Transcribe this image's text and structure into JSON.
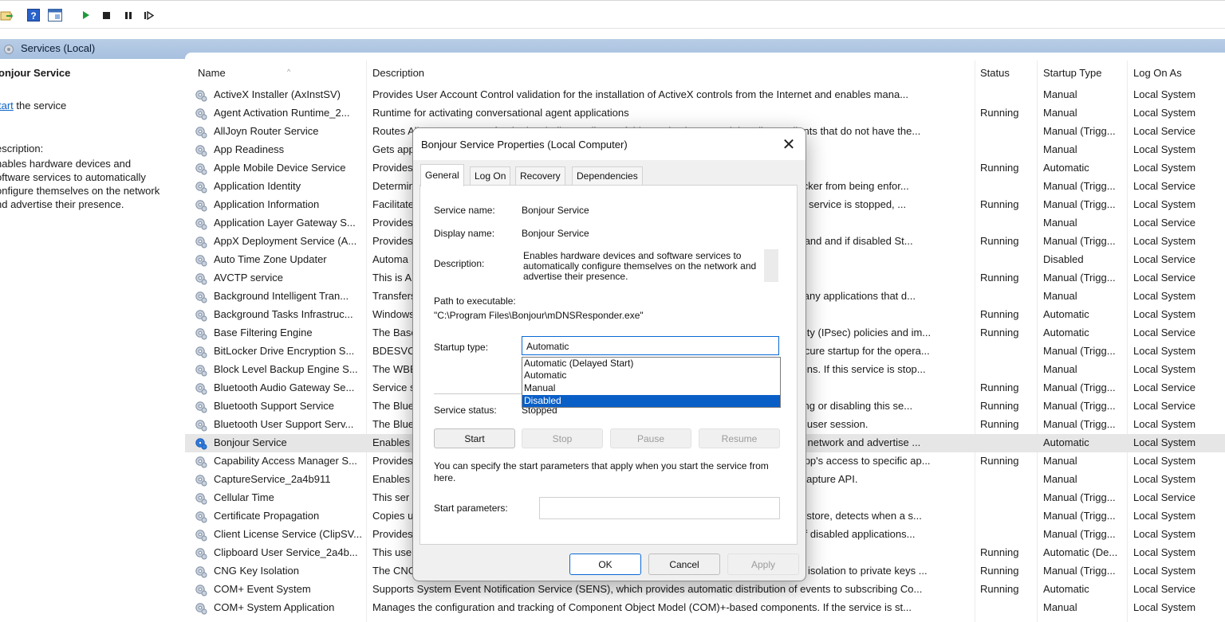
{
  "scope": {
    "title": "Services (Local)"
  },
  "left_pane": {
    "title": "onjour Service",
    "start_link": "tart",
    "start_prefix": "S",
    "start_suffix": " the service",
    "desc_label": "escription:",
    "desc_lines": [
      "nables hardware devices and",
      "oftware services to automatically",
      "onfigure themselves on the network",
      "nd advertise their presence."
    ]
  },
  "columns": {
    "name": "Name",
    "description": "Description",
    "status": "Status",
    "startup_type": "Startup Type",
    "log_on_as": "Log On As"
  },
  "rows": [
    {
      "name": "ActiveX Installer (AxInstSV)",
      "desc": "Provides User Account Control validation for the installation of ActiveX controls from the Internet and enables mana...",
      "status": "",
      "startup": "Manual",
      "logon": "Local System"
    },
    {
      "name": "Agent Activation Runtime_2...",
      "desc": "Runtime for activating conversational agent applications",
      "status": "Running",
      "startup": "Manual",
      "logon": "Local System"
    },
    {
      "name": "AllJoyn Router Service",
      "desc": "Routes AllJoyn messages for the local AllJoyn clients. If this service is stopped the AllJoyn clients that do not have the...",
      "status": "",
      "startup": "Manual (Trigg...",
      "logon": "Local Service"
    },
    {
      "name": "App Readiness",
      "desc": "Gets apps ready for use the first time a user signs in to this PC and when adding new apps.",
      "status": "",
      "startup": "Manual",
      "logon": "Local System"
    },
    {
      "name": "Apple Mobile Device Service",
      "desc": "Provides",
      "status": "Running",
      "startup": "Automatic",
      "logon": "Local System"
    },
    {
      "name": "Application Identity",
      "desc": "Determines and verifies the identity of an application. Disabling this service will prevent AppLocker from being enfor...",
      "status": "",
      "startup": "Manual (Trigg...",
      "logon": "Local Service"
    },
    {
      "name": "Application Information",
      "desc": "Facilitates the running of interactive applications with additional administrative privileges.  If this service is stopped, ...",
      "status": "Running",
      "startup": "Manual (Trigg...",
      "logon": "Local System"
    },
    {
      "name": "Application Layer Gateway S...",
      "desc": "Provides",
      "status": "",
      "startup": "Manual",
      "logon": "Local Service"
    },
    {
      "name": "AppX Deployment Service (A...",
      "desc": "Provides infrastructure support for deploying Store applications. This service is started on demand and if disabled St...",
      "status": "Running",
      "startup": "Manual (Trigg...",
      "logon": "Local System"
    },
    {
      "name": "Auto Time Zone Updater",
      "desc": "Automa",
      "status": "",
      "startup": "Disabled",
      "logon": "Local Service"
    },
    {
      "name": "AVCTP service",
      "desc": "This is A",
      "status": "Running",
      "startup": "Manual (Trigg...",
      "logon": "Local Service"
    },
    {
      "name": "Background Intelligent Tran...",
      "desc": "Transfers files in the background using idle network bandwidth. If the service is disabled, then any applications that d...",
      "status": "",
      "startup": "Manual",
      "logon": "Local System"
    },
    {
      "name": "Background Tasks Infrastruc...",
      "desc": "Windows infrastructure service that controls which background tasks can run on the system.",
      "status": "Running",
      "startup": "Automatic",
      "logon": "Local System"
    },
    {
      "name": "Base Filtering Engine",
      "desc": "The Base Filtering Engine (BFE) is a service that manages firewall and Internet Protocol security (IPsec) policies and im...",
      "status": "Running",
      "startup": "Automatic",
      "logon": "Local Service"
    },
    {
      "name": "BitLocker Drive Encryption S...",
      "desc": "BDESVC hosts the BitLocker Drive Encryption service. BitLocker Drive Encryption provides secure startup for the opera...",
      "status": "",
      "startup": "Manual (Trigg...",
      "logon": "Local System"
    },
    {
      "name": "Block Level Backup Engine S...",
      "desc": "The WBENGINE service is used by Windows Backup to perform backup and recovery operations. If this service is stop...",
      "status": "",
      "startup": "Manual",
      "logon": "Local System"
    },
    {
      "name": "Bluetooth Audio Gateway Se...",
      "desc": "Service s",
      "status": "Running",
      "startup": "Manual (Trigg...",
      "logon": "Local Service"
    },
    {
      "name": "Bluetooth Support Service",
      "desc": "The Bluetooth service supports discovery and association of remote Bluetooth devices.  Stopping or disabling this se...",
      "status": "Running",
      "startup": "Manual (Trigg...",
      "logon": "Local Service"
    },
    {
      "name": "Bluetooth User Support Serv...",
      "desc": "The Bluetooth user service supports proper functionality of Bluetooth features relevant to each user session.",
      "status": "Running",
      "startup": "Manual (Trigg...",
      "logon": "Local System"
    },
    {
      "name": "Bonjour Service",
      "desc": "Enables hardware devices and software services to automatically configure themselves on the network and advertise ...",
      "status": "",
      "startup": "Automatic",
      "logon": "Local System",
      "selected": true
    },
    {
      "name": "Capability Access Manager S...",
      "desc": "Provides facilities for managing UWP apps access to app capabilities as well as checking an app's access to specific ap...",
      "status": "Running",
      "startup": "Manual",
      "logon": "Local System"
    },
    {
      "name": "CaptureService_2a4b911",
      "desc": "Enables optional screen capture functionality for applications that call the Windows.Graphics.Capture API.",
      "status": "",
      "startup": "Manual",
      "logon": "Local System"
    },
    {
      "name": "Cellular Time",
      "desc": "This ser",
      "status": "",
      "startup": "Manual (Trigg...",
      "logon": "Local Service"
    },
    {
      "name": "Certificate Propagation",
      "desc": "Copies user certificates and root certificates from smart cards into the current user's certificate store, detects when a s...",
      "status": "",
      "startup": "Manual (Trigg...",
      "logon": "Local System"
    },
    {
      "name": "Client License Service (ClipSV...",
      "desc": "Provides infrastructure support for the Microsoft Store. This service is started on demand and if disabled applications...",
      "status": "",
      "startup": "Manual (Trigg...",
      "logon": "Local System"
    },
    {
      "name": "Clipboard User Service_2a4b...",
      "desc": "This use",
      "status": "Running",
      "startup": "Automatic (De...",
      "logon": "Local System"
    },
    {
      "name": "CNG Key Isolation",
      "desc": "The CNG key isolation service is hosted in the LSA process. The service provides key process isolation to private keys ...",
      "status": "Running",
      "startup": "Manual (Trigg...",
      "logon": "Local System"
    },
    {
      "name": "COM+ Event System",
      "desc": "Supports System Event Notification Service (SENS), which provides automatic distribution of events to subscribing Co...",
      "status": "Running",
      "startup": "Automatic",
      "logon": "Local Service"
    },
    {
      "name": "COM+ System Application",
      "desc": "Manages the configuration and tracking of Component Object Model (COM)+-based components. If the service is st...",
      "status": "",
      "startup": "Manual",
      "logon": "Local System"
    }
  ],
  "dialog": {
    "title": "Bonjour Service Properties (Local Computer)",
    "close_glyph": "✕",
    "tabs": [
      "General",
      "Log On",
      "Recovery",
      "Dependencies"
    ],
    "service_name_label": "Service name:",
    "service_name": "Bonjour Service",
    "display_name_label": "Display name:",
    "display_name": "Bonjour Service",
    "description_label": "Description:",
    "description": "Enables hardware devices and software services to automatically configure themselves on the network and advertise their presence.",
    "path_label": "Path to executable:",
    "path": "\"C:\\Program Files\\Bonjour\\mDNSResponder.exe\"",
    "startup_type_label": "Startup type:",
    "startup_type": "Automatic",
    "startup_options": [
      "Automatic (Delayed Start)",
      "Automatic",
      "Manual",
      "Disabled"
    ],
    "startup_highlighted": "Disabled",
    "service_status_label": "Service status:",
    "service_status": "Stopped",
    "buttons": {
      "start": "Start",
      "stop": "Stop",
      "pause": "Pause",
      "resume": "Resume"
    },
    "params_hint": "You can specify the start parameters that apply when you start the service from here.",
    "params_label": "Start parameters:",
    "params_value": "",
    "ok": "OK",
    "cancel": "Cancel",
    "apply": "Apply"
  },
  "colors": {
    "header_strip": "#a7c0df",
    "selected_row": "#e6e6e6",
    "selection_blue": "#0a5fc7",
    "link_blue": "#0b62c4"
  }
}
